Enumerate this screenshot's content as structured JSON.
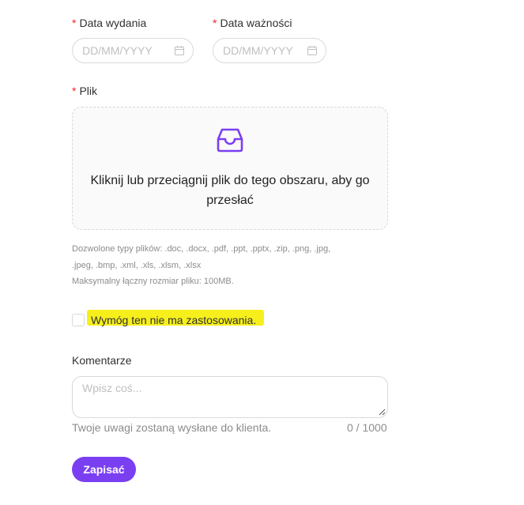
{
  "fields": {
    "issue_date": {
      "label": "Data wydania",
      "required_mark": "*",
      "placeholder": "DD/MM/YYYY"
    },
    "expiry_date": {
      "label": "Data ważności",
      "required_mark": "*",
      "placeholder": "DD/MM/YYYY"
    },
    "file": {
      "label": "Plik",
      "required_mark": "*"
    }
  },
  "upload": {
    "icon": "inbox-icon",
    "text": "Kliknij lub przeciągnij plik do tego obszaru, aby go przesłać",
    "allowed_types_line1": "Dozwolone typy plików: .doc, .docx, .pdf, .ppt, .pptx, .zip, .png, .jpg,",
    "allowed_types_line2": ".jpeg, .bmp, .xml, .xls, .xlsm, .xlsx",
    "max_size": "Maksymalny łączny rozmiar pliku: 100MB."
  },
  "not_applicable": {
    "label": "Wymóg ten nie ma zastosowania",
    "checked": false
  },
  "comments": {
    "label": "Komentarze",
    "placeholder": "Wpisz coś...",
    "hint": "Twoje uwagi zostaną wysłane do klienta.",
    "counter": "0 / 1000"
  },
  "save_button": {
    "label": "Zapisać"
  },
  "colors": {
    "accent": "#7b3ff2",
    "highlight": "#f7ef1c",
    "required": "#f5222d"
  }
}
